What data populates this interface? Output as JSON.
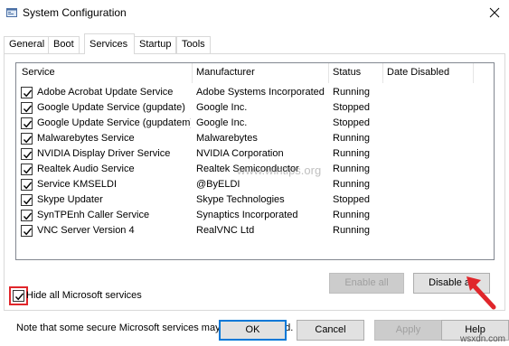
{
  "window": {
    "title": "System Configuration"
  },
  "tabs": [
    {
      "label": "General"
    },
    {
      "label": "Boot"
    },
    {
      "label": "Services"
    },
    {
      "label": "Startup"
    },
    {
      "label": "Tools"
    }
  ],
  "active_tab": "Services",
  "table": {
    "columns": [
      "Service",
      "Manufacturer",
      "Status",
      "Date Disabled"
    ],
    "rows": [
      {
        "checked": true,
        "service": "Adobe Acrobat Update Service",
        "manufacturer": "Adobe Systems Incorporated",
        "status": "Running",
        "date_disabled": ""
      },
      {
        "checked": true,
        "service": "Google Update Service (gupdate)",
        "manufacturer": "Google Inc.",
        "status": "Stopped",
        "date_disabled": ""
      },
      {
        "checked": true,
        "service": "Google Update Service (gupdatem)",
        "manufacturer": "Google Inc.",
        "status": "Stopped",
        "date_disabled": ""
      },
      {
        "checked": true,
        "service": "Malwarebytes Service",
        "manufacturer": "Malwarebytes",
        "status": "Running",
        "date_disabled": ""
      },
      {
        "checked": true,
        "service": "NVIDIA Display Driver Service",
        "manufacturer": "NVIDIA Corporation",
        "status": "Running",
        "date_disabled": ""
      },
      {
        "checked": true,
        "service": "Realtek Audio Service",
        "manufacturer": "Realtek Semiconductor",
        "status": "Running",
        "date_disabled": ""
      },
      {
        "checked": true,
        "service": "Service KMSELDI",
        "manufacturer": "@ByELDI",
        "status": "Running",
        "date_disabled": ""
      },
      {
        "checked": true,
        "service": "Skype Updater",
        "manufacturer": "Skype Technologies",
        "status": "Stopped",
        "date_disabled": ""
      },
      {
        "checked": true,
        "service": "SynTPEnh Caller Service",
        "manufacturer": "Synaptics Incorporated",
        "status": "Running",
        "date_disabled": ""
      },
      {
        "checked": true,
        "service": "VNC Server Version 4",
        "manufacturer": "RealVNC Ltd",
        "status": "Running",
        "date_disabled": ""
      }
    ]
  },
  "note": "Note that some secure Microsoft services may not be disabled.",
  "buttons": {
    "enable_all": "Enable all",
    "disable_all": "Disable all",
    "ok": "OK",
    "cancel": "Cancel",
    "apply": "Apply",
    "help": "Help"
  },
  "hide_microsoft": {
    "label": "Hide all Microsoft services",
    "checked": true
  },
  "watermarks": {
    "center": "www.wintips.org",
    "corner": "wsxdn.com"
  },
  "colors": {
    "highlight": "#e0262b",
    "default_button_border": "#0078d7"
  },
  "icons": [
    "system-config-icon",
    "close-icon",
    "checkbox-checked-icon",
    "red-arrow-icon"
  ]
}
